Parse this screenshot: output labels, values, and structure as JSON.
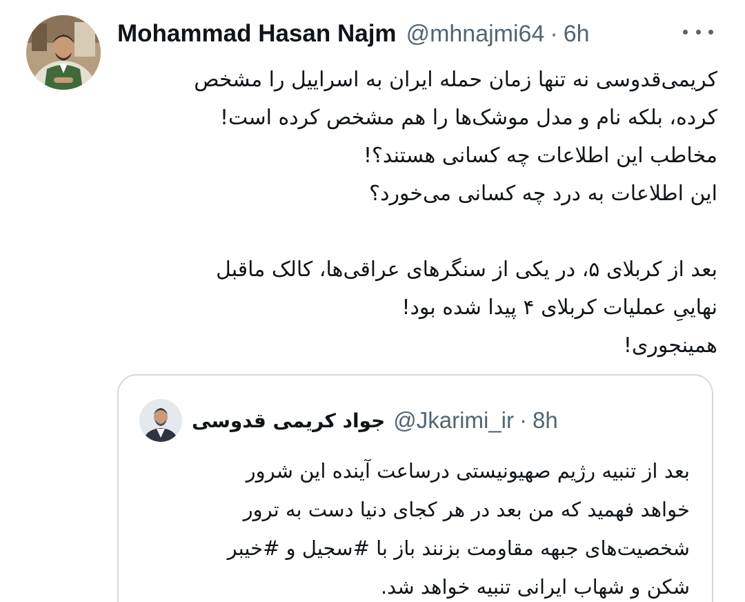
{
  "author": {
    "name": "Mohammad Hasan Najm",
    "handle": "@mhnajmi64",
    "separator": "·",
    "time": "6h"
  },
  "icons": {
    "more": "more-horizontal-icon",
    "avatar": "user-avatar",
    "quoted_avatar": "quoted-user-avatar"
  },
  "tweet": {
    "lines": [
      "کریمی‌قدوسی نه تنها زمان حمله ایران به اسراییل را مشخص",
      "کرده، بلکه نام و مدل موشک‌ها را هم مشخص کرده است!",
      "مخاطب این اطلاعات چه کسانی هستند؟!",
      "این اطلاعات به درد چه کسانی می‌خورد؟",
      "",
      "بعد از کربلای ۵، در یکی از سنگرهای عراقی‌ها، کالک ماقبل",
      "نهاییِ عملیات کربلای ۴ پیدا شده بود!",
      "همینجوری!"
    ]
  },
  "quoted": {
    "name": "جواد کریمی قدوسی",
    "handle": "@Jkarimi_ir",
    "separator": "·",
    "time": "8h",
    "lines": [
      "بعد از تنبیه رژیم صهیونیستی درساعت آینده این شرور",
      "خواهد فهمید که من بعد در هر کجای دنیا دست به ترور",
      "شخصیت‌های جبهه مقاومت بزنند باز با #سجیل و #خیبر",
      "شکن و شهاب ایرانی تنبیه خواهد شد."
    ]
  },
  "colors": {
    "text": "#0f1419",
    "secondary": "#536471",
    "border": "#cfd9de"
  }
}
